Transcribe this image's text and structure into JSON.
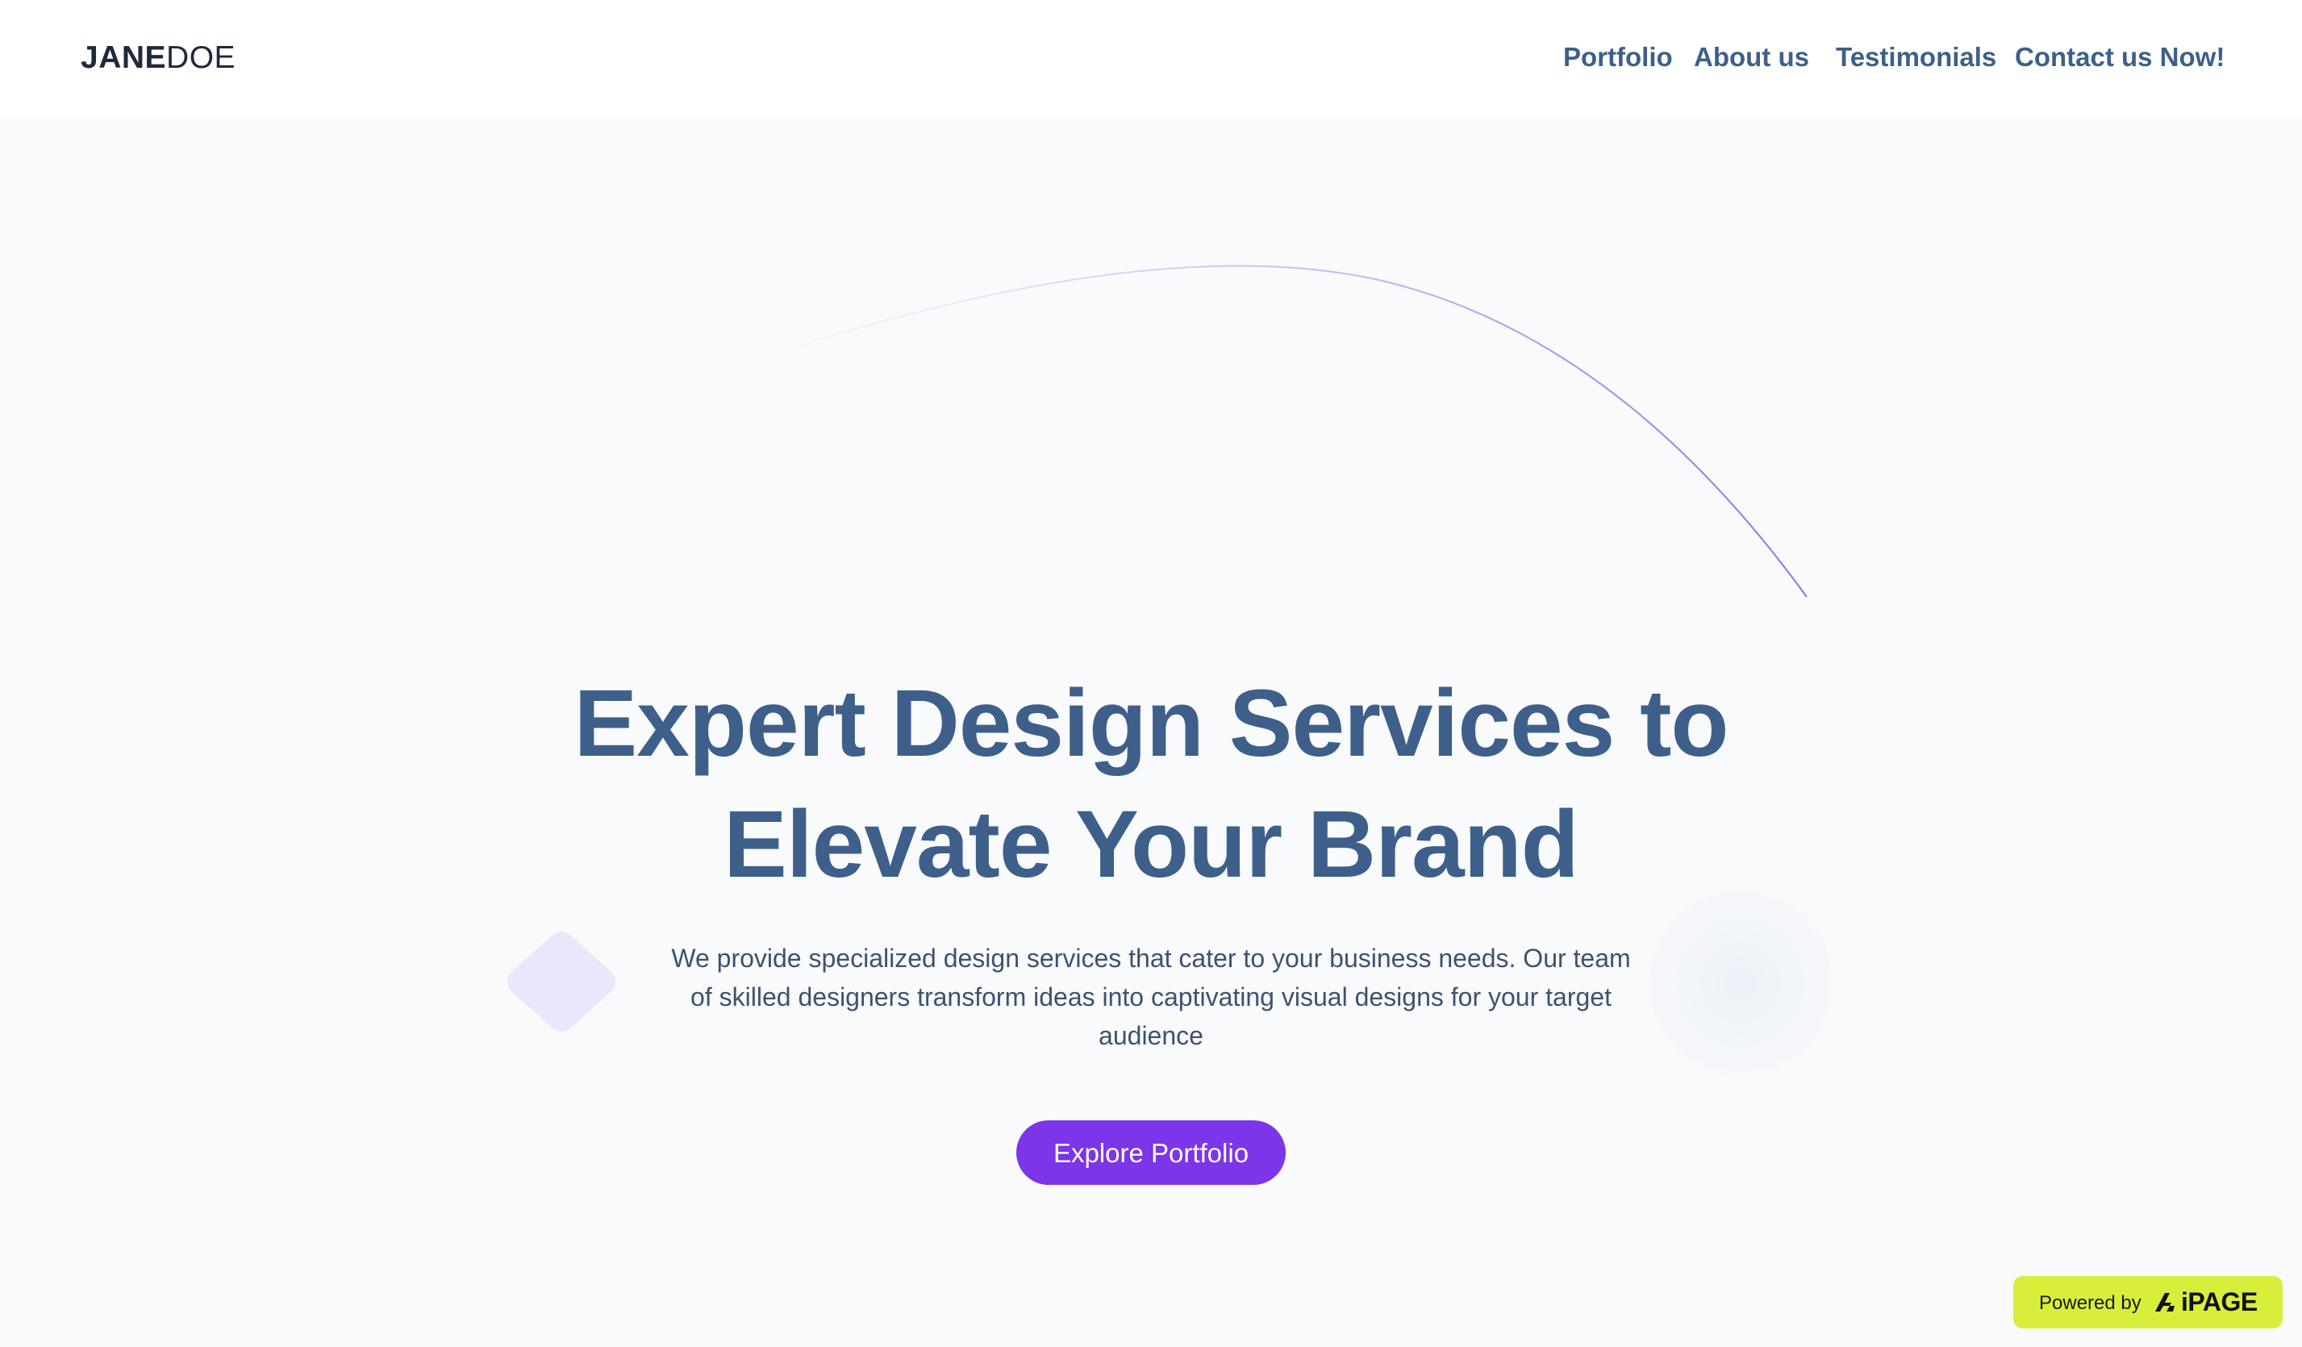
{
  "header": {
    "logo_bold": "JANE",
    "logo_light": "DOE",
    "nav": [
      {
        "label": "Portfolio"
      },
      {
        "label": "About us"
      },
      {
        "label": "Testimonials"
      },
      {
        "label": "Contact us Now!"
      }
    ]
  },
  "hero": {
    "title_line1": "Expert Design Services to",
    "title_line2": "Elevate Your Brand",
    "subtitle": "We provide specialized design services that cater to your business needs. Our team of skilled designers transform ideas into captivating visual designs for your target audience",
    "cta_label": "Explore Portfolio"
  },
  "badge": {
    "powered_label": "Powered by",
    "brand": "iPAGE"
  },
  "colors": {
    "nav_text": "#3e5f8a",
    "title_text": "#3e5f8a",
    "accent": "#7c35e8",
    "badge_bg": "#d9ee3b",
    "page_bg": "#f8fafc"
  },
  "icons": [
    "arc-decoration",
    "diamond-decoration",
    "circle-decoration",
    "aipage-logo-icon"
  ]
}
